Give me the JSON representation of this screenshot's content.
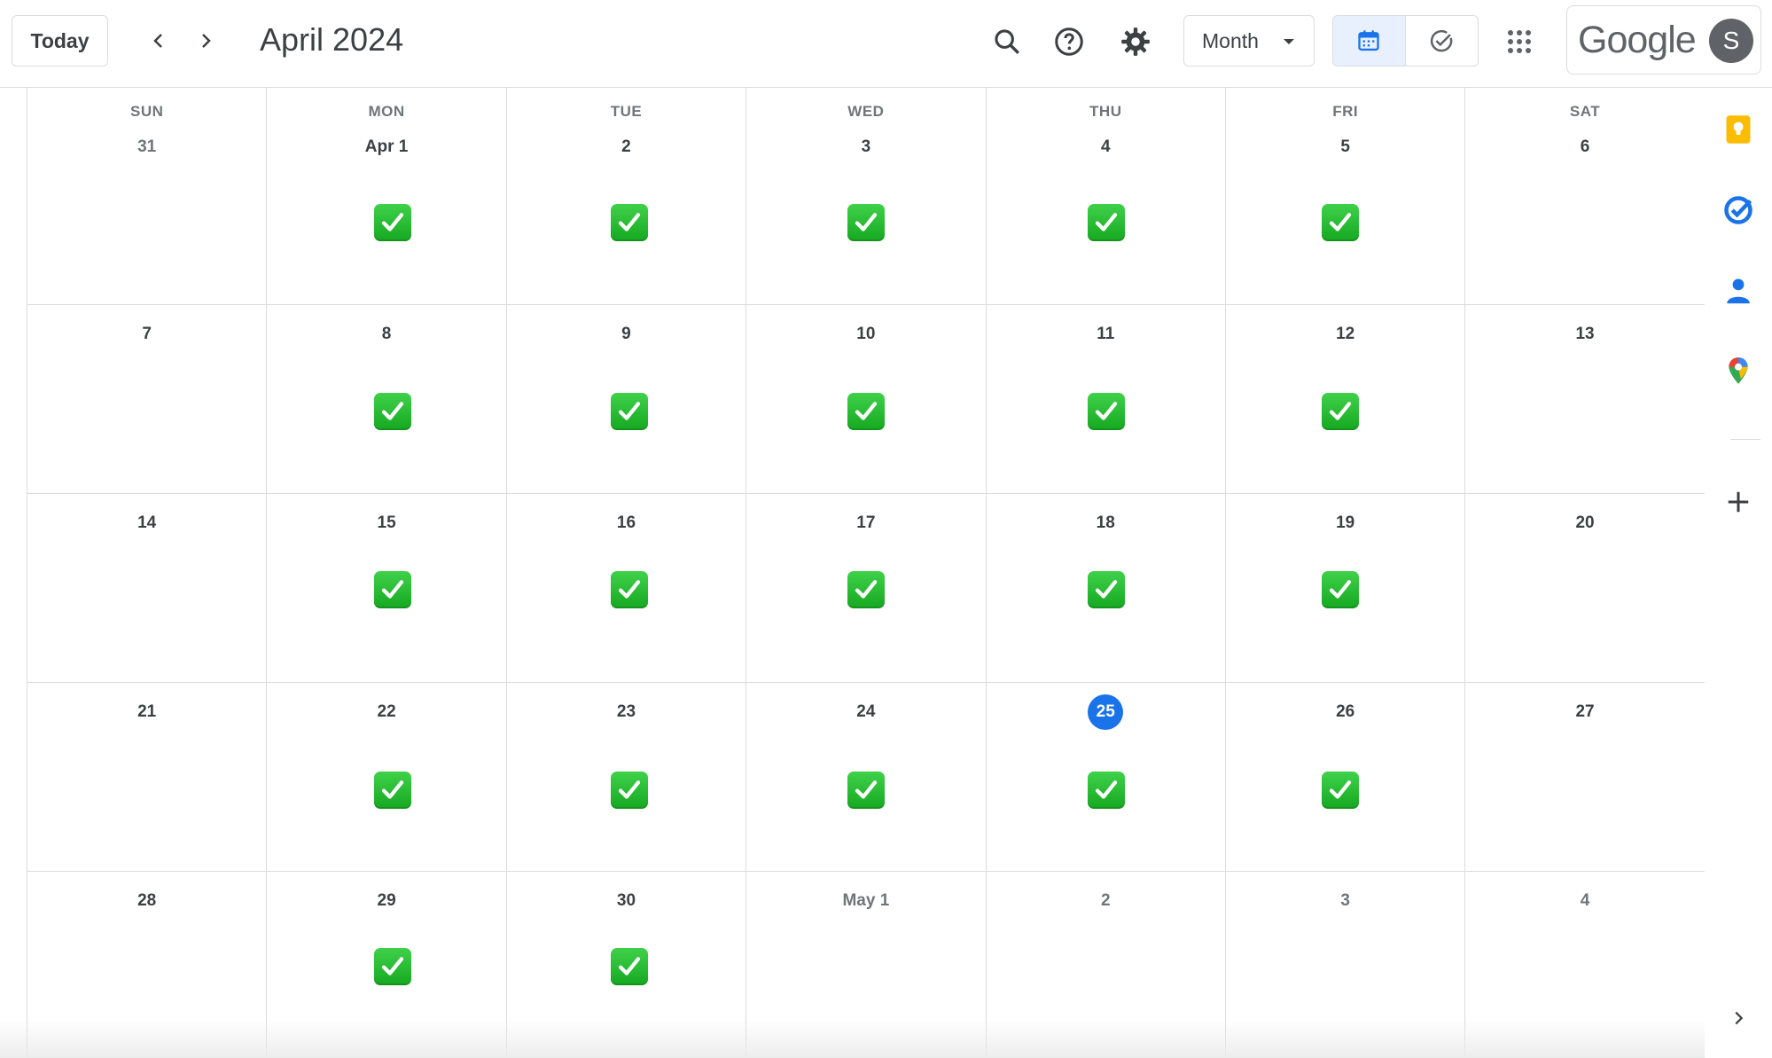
{
  "header": {
    "today_label": "Today",
    "title": "April 2024",
    "view_label": "Month",
    "brand": "Google",
    "avatar_initial": "S",
    "icons": [
      "chevron-left-icon",
      "chevron-right-icon",
      "search-icon",
      "help-icon",
      "settings-icon",
      "calendar-icon",
      "task-check-icon",
      "apps-grid-icon"
    ]
  },
  "calendar": {
    "day_headers": [
      "SUN",
      "MON",
      "TUE",
      "WED",
      "THU",
      "FRI",
      "SAT"
    ],
    "weeks": [
      [
        "31",
        "Apr 1",
        "2",
        "3",
        "4",
        "5",
        "6"
      ],
      [
        "7",
        "8",
        "9",
        "10",
        "11",
        "12",
        "13"
      ],
      [
        "14",
        "15",
        "16",
        "17",
        "18",
        "19",
        "20"
      ],
      [
        "21",
        "22",
        "23",
        "24",
        "25",
        "26",
        "27"
      ],
      [
        "28",
        "29",
        "30",
        "May 1",
        "2",
        "3",
        "4"
      ]
    ],
    "other_month_days": [
      "31",
      "May 1",
      "2",
      "3",
      "4"
    ],
    "today": "25",
    "checkmark_days": [
      [
        "Apr 1",
        "2",
        "3",
        "4",
        "5"
      ],
      [
        "8",
        "9",
        "10",
        "11",
        "12"
      ],
      [
        "15",
        "16",
        "17",
        "18",
        "19"
      ],
      [
        "22",
        "23",
        "24",
        "25",
        "26"
      ],
      [
        "29",
        "30"
      ]
    ],
    "checkmark_icon": "green-check-icon"
  },
  "side_panel": {
    "icons": [
      "keep-icon",
      "tasks-icon",
      "contacts-icon",
      "maps-icon",
      "add-icon",
      "expand-chevron-icon"
    ]
  },
  "colors": {
    "accent": "#1a73e8",
    "check_green": "#17a821",
    "border": "#dadce0",
    "text": "#3c4043"
  }
}
